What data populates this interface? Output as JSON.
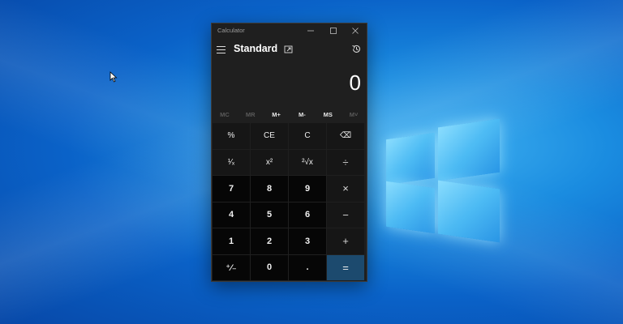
{
  "window": {
    "title": "Calculator"
  },
  "header": {
    "mode": "Standard"
  },
  "display": {
    "value": "0"
  },
  "memory": [
    "MC",
    "MR",
    "M+",
    "M-",
    "MS",
    "M˅"
  ],
  "keys": [
    [
      "%",
      "CE",
      "C",
      "⌫"
    ],
    [
      "¹⁄ₓ",
      "x²",
      "²√x",
      "÷"
    ],
    [
      "7",
      "8",
      "9",
      "×"
    ],
    [
      "4",
      "5",
      "6",
      "−"
    ],
    [
      "1",
      "2",
      "3",
      "+"
    ],
    [
      "⁺⁄₋",
      "0",
      ".",
      "="
    ]
  ],
  "colors": {
    "window_bg": "#1f1f1f",
    "fn_key_bg": "#161616",
    "num_key_bg": "#060606",
    "equals_bg": "#1c4a6e",
    "desktop_blue": "#0a62c8"
  }
}
